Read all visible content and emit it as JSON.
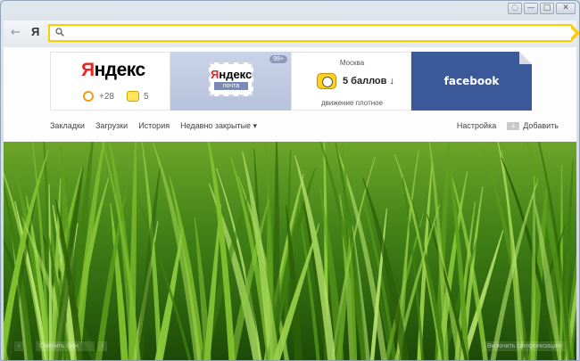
{
  "toolbar": {
    "back_glyph": "←",
    "yandex_button": "Я",
    "address_value": "",
    "window_buttons": [
      "◌",
      "—",
      "□",
      "✕"
    ]
  },
  "tiles": {
    "yandex": {
      "logo_first": "Я",
      "logo_rest": "ндекс",
      "temperature": "+28",
      "traffic_score": "5"
    },
    "mail": {
      "logo_first": "Я",
      "logo_rest": "ндекс",
      "sub": "почта",
      "badge": "99+"
    },
    "traffic": {
      "city": "Москва",
      "score": "5 баллов ↓",
      "status": "движение плотное"
    },
    "facebook": {
      "label": "facebook"
    }
  },
  "links": {
    "bookmarks": "Закладки",
    "downloads": "Загрузки",
    "history": "История",
    "recently_closed": "Недавно закрытые ▾",
    "settings": "Настройка",
    "add": "Добавить",
    "add_icon": "+"
  },
  "bottom": {
    "prev": "‹",
    "change_bg": "Сменить фон",
    "next": "›",
    "sync": "Включить синхронизацию"
  },
  "colors": {
    "accent": "#ffcc00",
    "facebook": "#3b5998",
    "mail_tile": "#c9d3e8"
  }
}
